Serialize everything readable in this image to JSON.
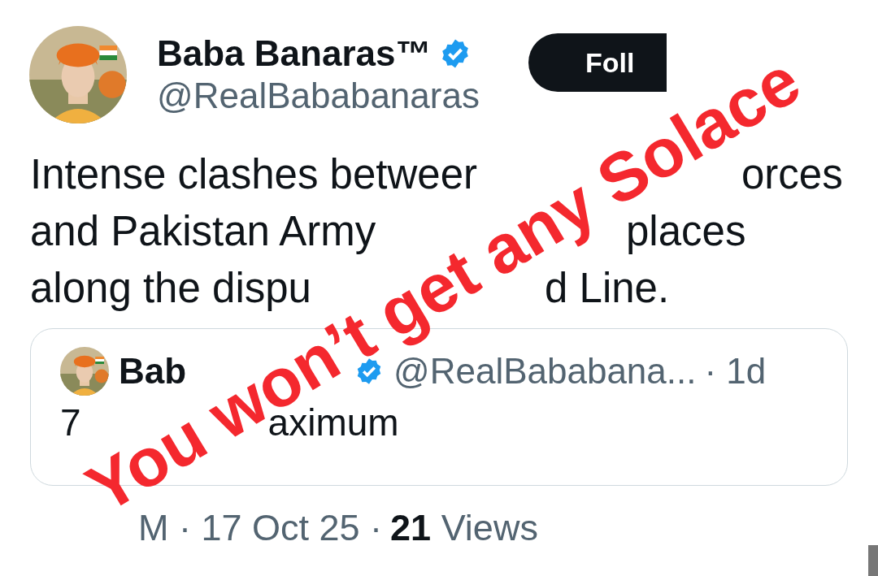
{
  "author": {
    "name": "Baba Banaras™",
    "verified": true,
    "handle": "@RealBababanaras"
  },
  "follow_button": {
    "label": "Foll"
  },
  "body_lines": [
    [
      "Intense clashes betweer",
      "orces"
    ],
    [
      "and Pakistan Army",
      "places"
    ],
    [
      "along the dispu",
      "d Line."
    ]
  ],
  "quoted": {
    "name": "Bab",
    "verified": true,
    "handle": "@RealBababana...",
    "time": "· 1d",
    "text": [
      "7",
      "aximum"
    ]
  },
  "footer": {
    "time": "M · 17 Oct 25 ·",
    "views_count": "21",
    "views_label": "Views"
  },
  "overlay": {
    "words": [
      "You",
      "won’t",
      "get",
      "any",
      "Solace"
    ]
  }
}
